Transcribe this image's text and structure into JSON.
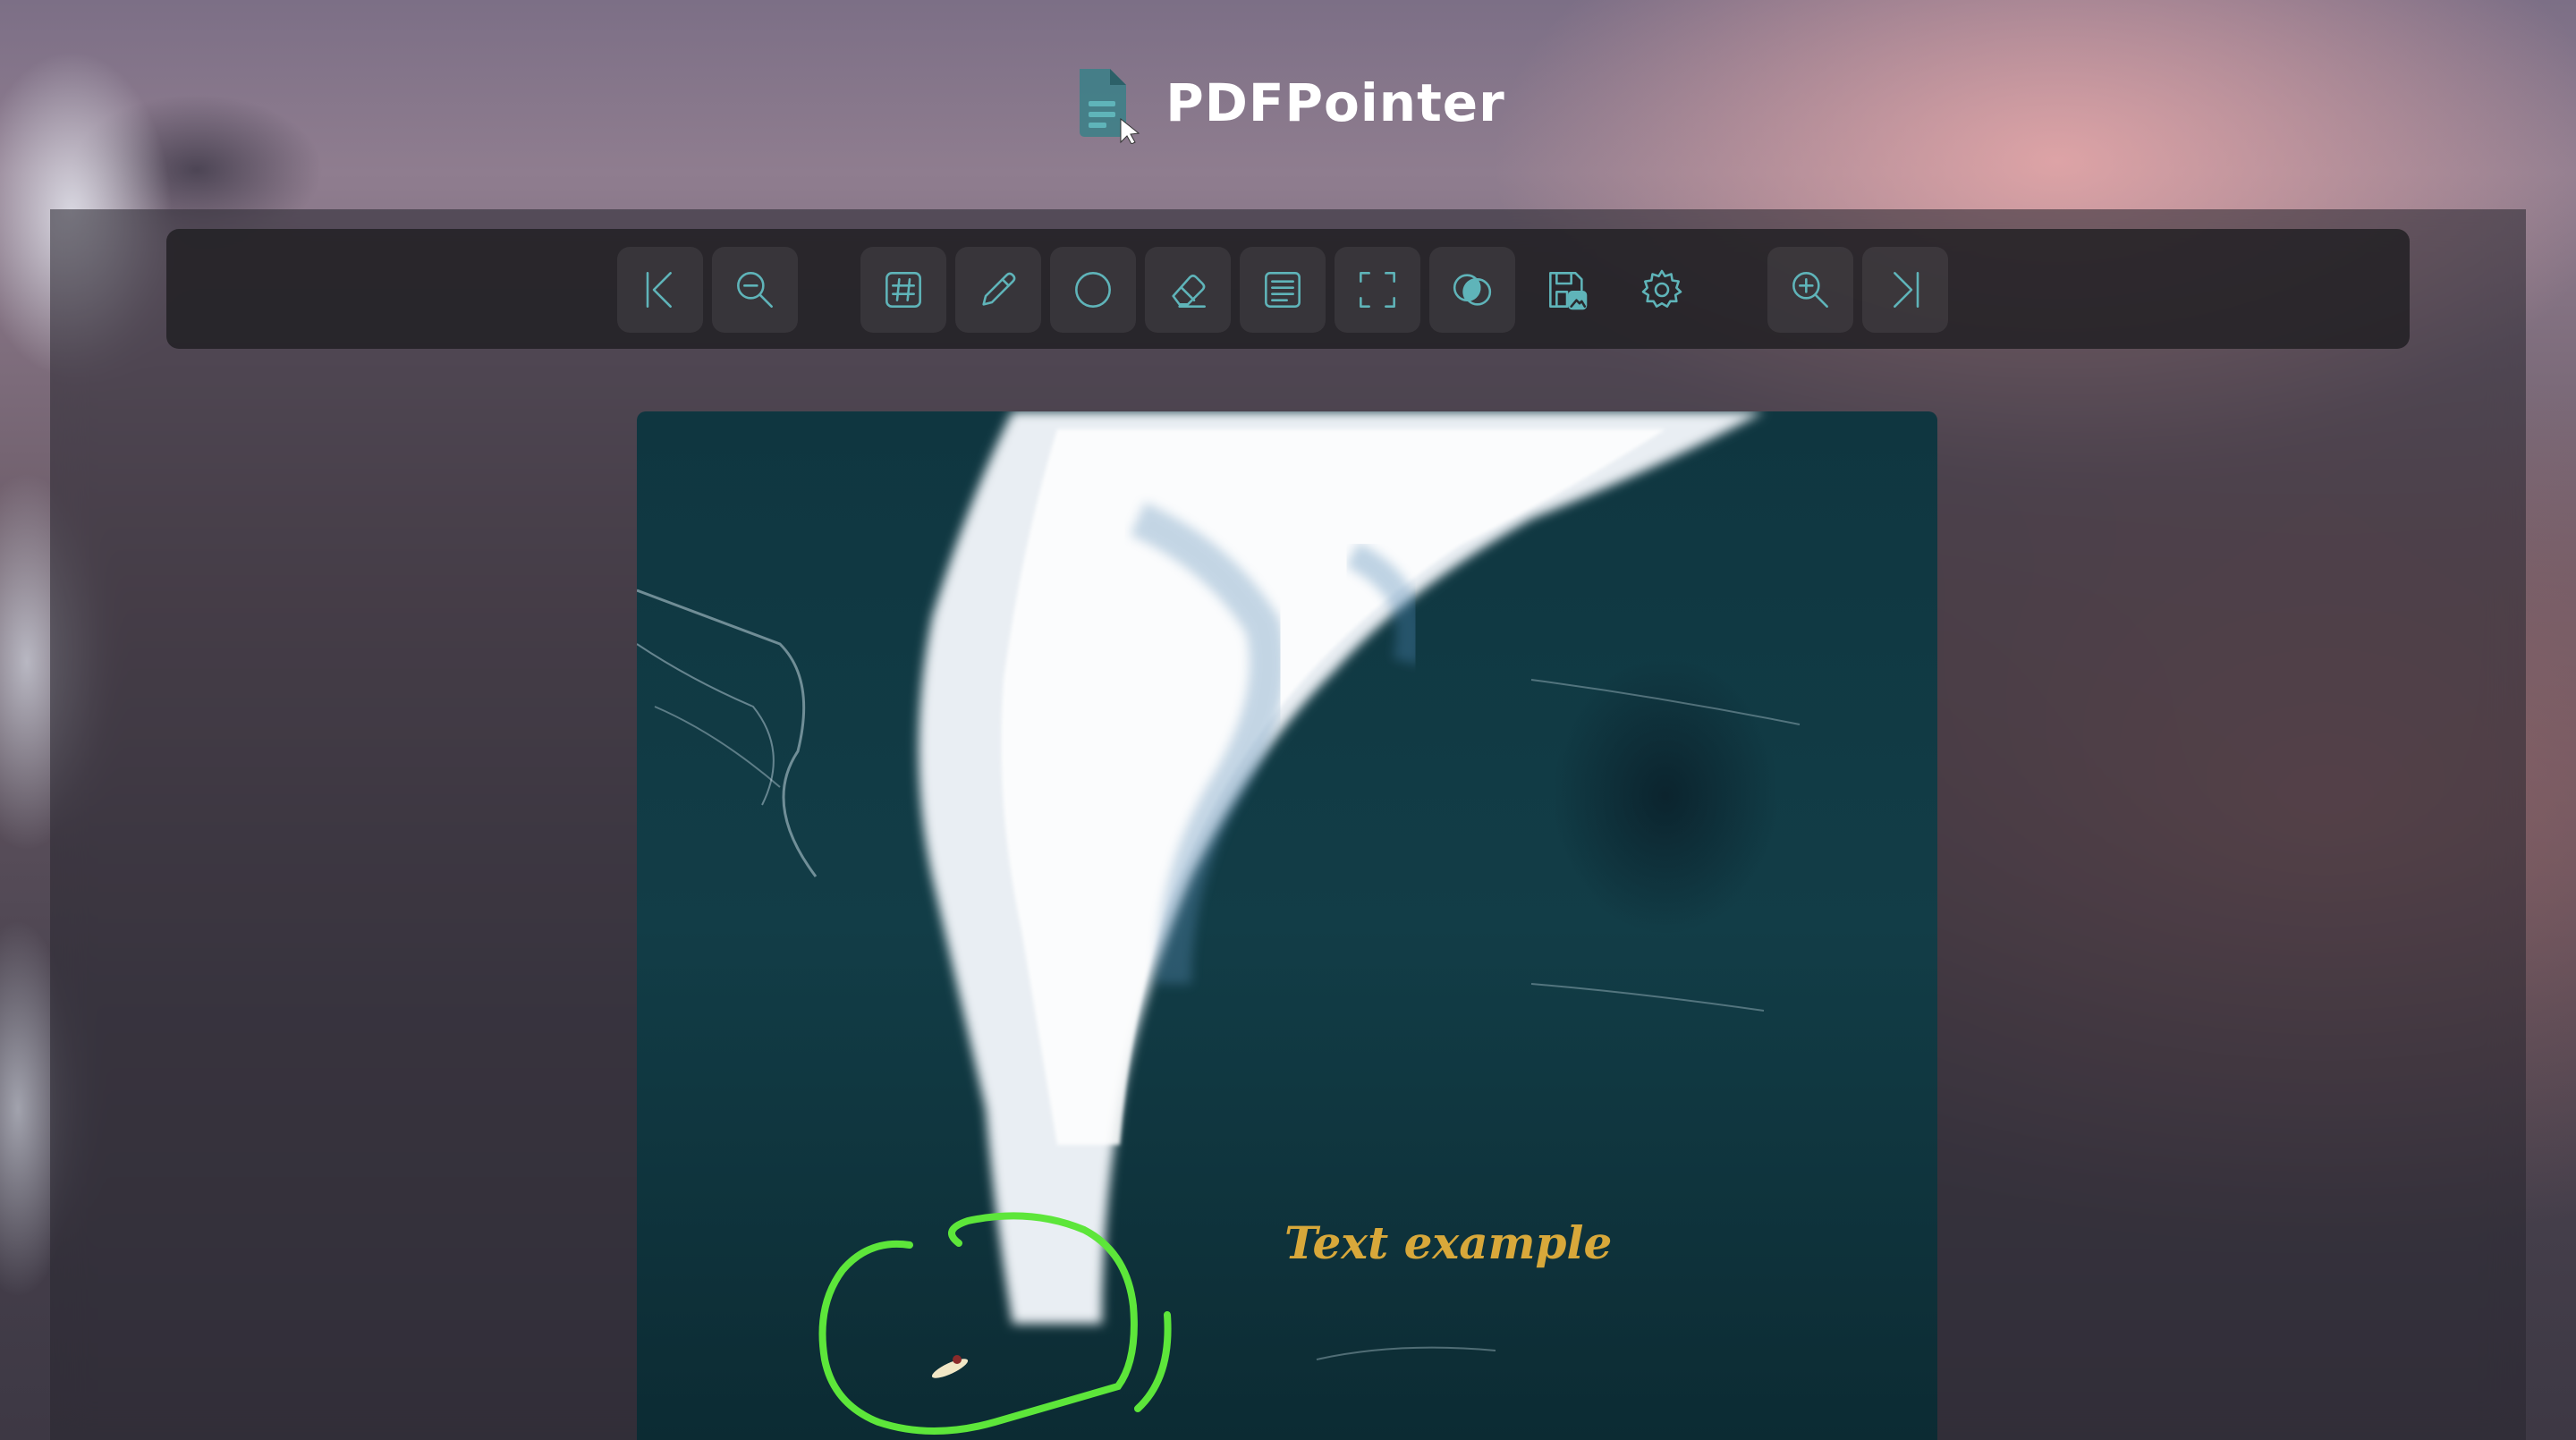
{
  "app": {
    "name": "PDFPointer"
  },
  "toolbar": {
    "buttons": [
      {
        "name": "first-page",
        "icon": "first-page-icon"
      },
      {
        "name": "zoom-out",
        "icon": "zoom-out-icon"
      },
      {
        "name": "page-number",
        "icon": "hash-icon"
      },
      {
        "name": "pencil",
        "icon": "pencil-icon"
      },
      {
        "name": "circle",
        "icon": "circle-icon"
      },
      {
        "name": "eraser",
        "icon": "eraser-icon"
      },
      {
        "name": "text",
        "icon": "text-lines-icon"
      },
      {
        "name": "fullscreen",
        "icon": "fullscreen-icon"
      },
      {
        "name": "blend",
        "icon": "overlap-circles-icon"
      },
      {
        "name": "save-image",
        "icon": "save-image-icon"
      },
      {
        "name": "settings",
        "icon": "gear-icon"
      },
      {
        "name": "zoom-in",
        "icon": "zoom-in-icon"
      },
      {
        "name": "last-page",
        "icon": "last-page-icon"
      }
    ],
    "icon_color": "#5fb4b9"
  },
  "document": {
    "annotation_text": "Text example",
    "annotation_text_color": "#d8a83a",
    "annotation_stroke_color": "#5de63a"
  }
}
